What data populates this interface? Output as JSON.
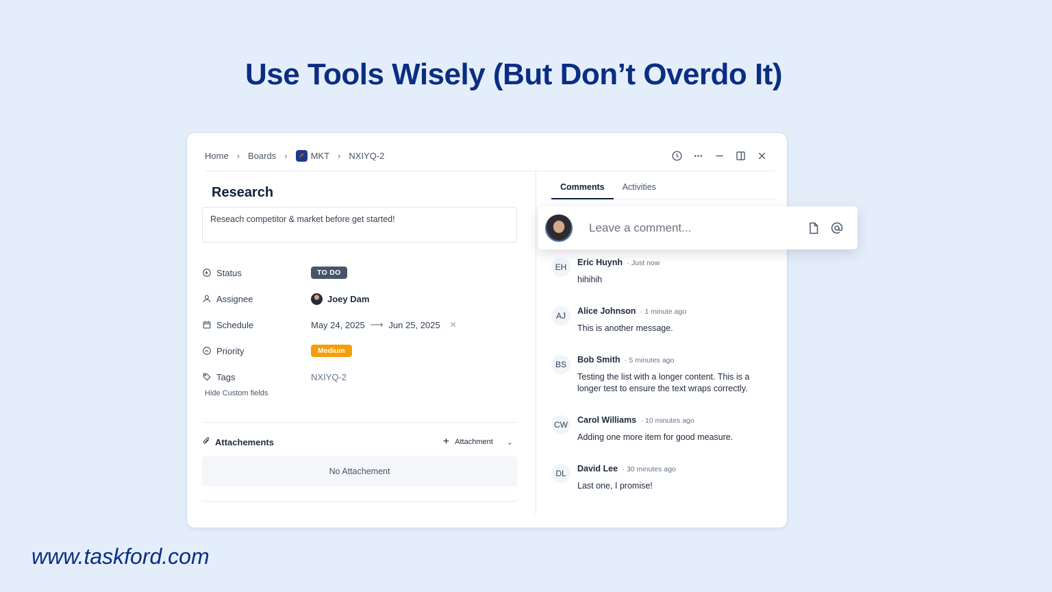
{
  "headline": "Use Tools Wisely (But Don’t Overdo It)",
  "footer_url": "www.taskford.com",
  "breadcrumb": {
    "home": "Home",
    "boards": "Boards",
    "project": "MKT",
    "task_id": "NXIYQ-2"
  },
  "task": {
    "title": "Research",
    "description": "Reseach competitor & market before get started!"
  },
  "properties": {
    "status_label": "Status",
    "status_value": "TO DO",
    "assignee_label": "Assignee",
    "assignee_value": "Joey Dam",
    "schedule_label": "Schedule",
    "schedule_start": "May 24, 2025",
    "schedule_end": "Jun 25, 2025",
    "priority_label": "Priority",
    "priority_value": "Medium",
    "tags_label": "Tags",
    "tags_value": "NXIYQ-2",
    "hide_custom_fields": "Hide Custom fields"
  },
  "attachments": {
    "label": "Attachements",
    "add_label": "Attachment",
    "empty": "No Attachement"
  },
  "tabs": [
    "Comments",
    "Activities"
  ],
  "comment_input": {
    "placeholder": "Leave a comment..."
  },
  "comments": [
    {
      "initials": "EH",
      "name": "Eric Huynh",
      "time": "· Just now",
      "text": "hihihih"
    },
    {
      "initials": "AJ",
      "name": "Alice Johnson",
      "time": "· 1 minute ago",
      "text": "This is another message."
    },
    {
      "initials": "BS",
      "name": "Bob Smith",
      "time": "· 5 minutes ago",
      "text": "Testing the list with a longer content. This is a longer test to ensure the text wraps correctly."
    },
    {
      "initials": "CW",
      "name": "Carol Williams",
      "time": "· 10 minutes ago",
      "text": "Adding one more item for good measure."
    },
    {
      "initials": "DL",
      "name": "David Lee",
      "time": "· 30 minutes ago",
      "text": "Last one, I promise!"
    }
  ],
  "colors": {
    "background": "#e4eefb",
    "headline": "#0b2d83",
    "status_badge": "#475569",
    "priority_badge": "#f59e0b"
  }
}
